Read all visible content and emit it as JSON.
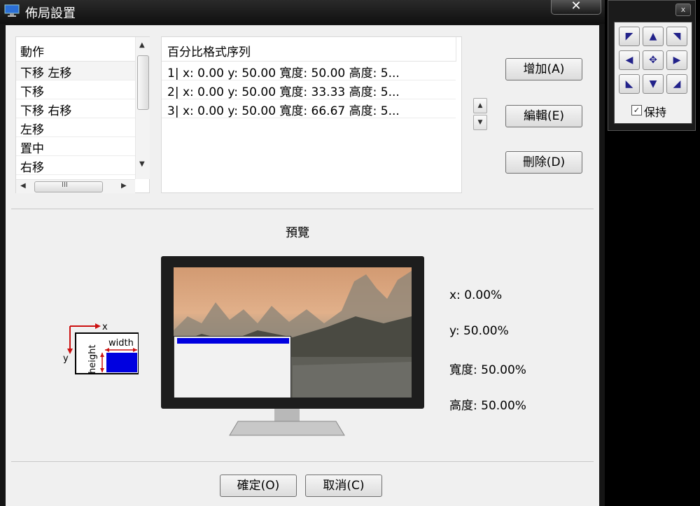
{
  "window": {
    "title": "佈局設置",
    "close_glyph": "✕"
  },
  "actions": {
    "header": "動作",
    "items": [
      "下移 左移",
      "下移",
      "下移 右移",
      "左移",
      "置中",
      "右移"
    ],
    "hscroll_thumb": "III"
  },
  "percent": {
    "header": "百分比格式序列",
    "rows": [
      "1|  x:  0.00    y: 50.00    寬度:  50.00    高度:  5...",
      "2|  x:  0.00    y: 50.00    寬度:  33.33    高度:  5...",
      "3|  x:  0.00    y: 50.00    寬度:  66.67    高度:  5..."
    ]
  },
  "buttons": {
    "add": "增加(A)",
    "edit": "編輯(E)",
    "delete": "刪除(D)",
    "ok": "確定(O)",
    "cancel": "取消(C)"
  },
  "preview": {
    "title": "預覽",
    "diagram": {
      "x": "x",
      "y": "y",
      "width": "width",
      "height": "height"
    },
    "info": {
      "x": "x: 0.00%",
      "y": "y: 50.00%",
      "width": "寬度: 50.00%",
      "height": "高度: 50.00%"
    }
  },
  "side_panel": {
    "close_glyph": "x",
    "keep_label": "保持",
    "keep_checked": true,
    "arrows": [
      "◤",
      "▲",
      "◥",
      "◀",
      "✥",
      "▶",
      "◣",
      "▼",
      "◢"
    ]
  },
  "colors": {
    "accent_blue": "#0000e0",
    "arrow_red": "#cc1111",
    "pad_arrow": "#22228a"
  }
}
